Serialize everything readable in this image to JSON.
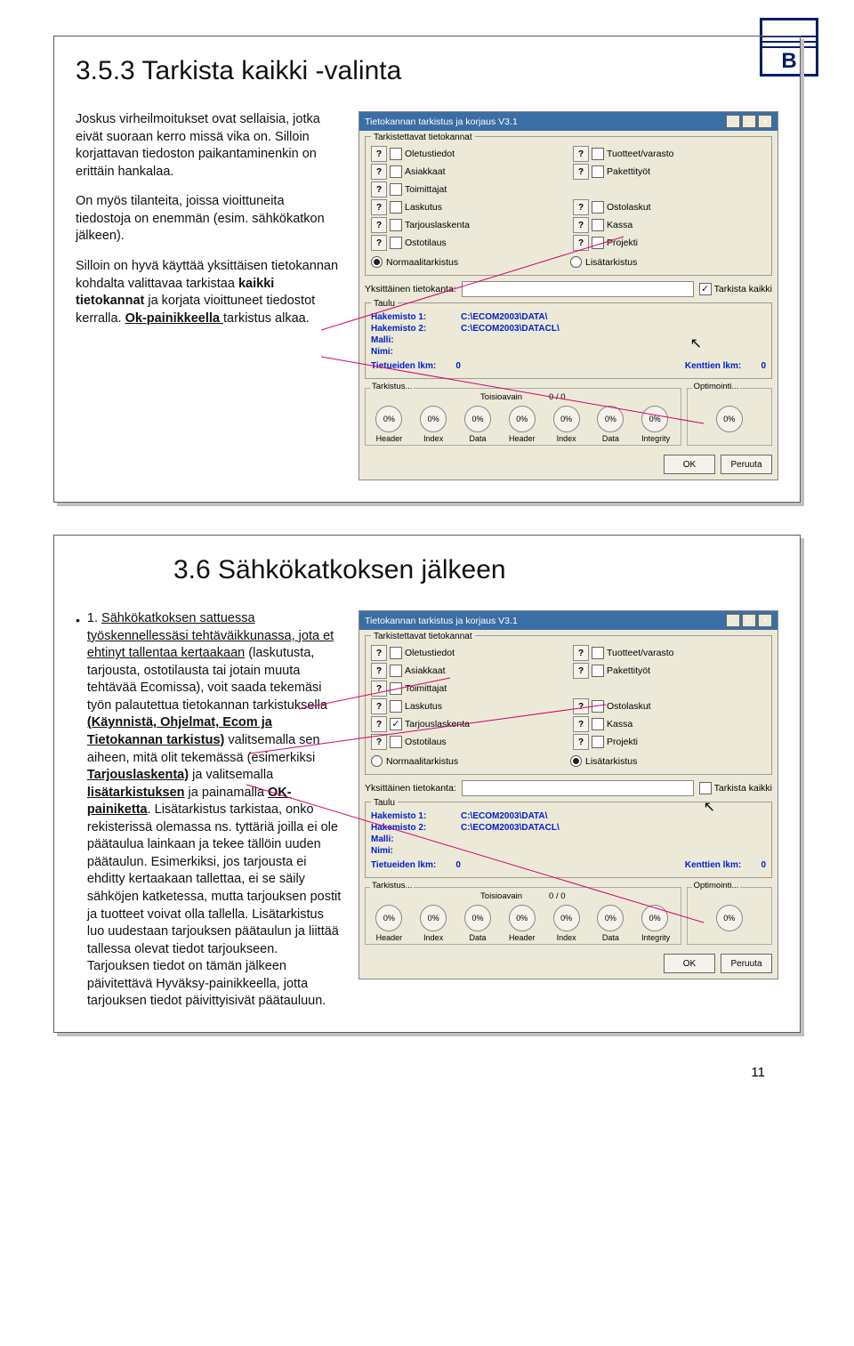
{
  "logo_letter": "B",
  "page_number": "11",
  "slide1": {
    "title": "3.5.3 Tarkista kaikki -valinta",
    "para1": "Joskus virheilmoitukset ovat sellaisia, jotka eivät suoraan kerro missä vika on. Silloin korjattavan tiedoston paikantaminenkin on erittäin hankalaa.",
    "para2": "On myös tilanteita, joissa vioittuneita tiedostoja on enemmän (esim. sähkökatkon jälkeen).",
    "para3a": "Silloin on hyvä käyttää yksittäisen tietokannan kohdalta valittavaa tarkistaa ",
    "para3b": "kaikki tietokannat",
    "para3c": " ja korjata vioittuneet tiedostot kerralla. ",
    "para3d": "Ok-painikkeella ",
    "para3e": "tarkistus alkaa."
  },
  "slide2": {
    "title": "3.6 Sähkökatkoksen jälkeen",
    "bullet_num": "1.",
    "t1": "Sähkökatkoksen sattuessa työskennellessäsi tehtäväikkunassa, jota et ehtinyt tallentaa kertaakaan",
    "t2": " (laskutusta, tarjousta, ostotilausta tai jotain muuta tehtävää Ecomissa), voit saada tekemäsi työn palautettua tietokannan tarkistuksella ",
    "t3": "(Käynnistä, Ohjelmat, Ecom ja Tietokannan tarkistus)",
    "t4": " valitsemalla sen aiheen, mitä olit tekemässä  (esimerkiksi ",
    "t5": "Tarjouslaskenta)",
    "t6": " ja valitsemalla ",
    "t7": "lisätarkistuksen",
    "t8": " ja painamalla ",
    "t9": "OK-painiketta",
    "t10": ". Lisätarkistus tarkistaa, onko rekisterissä olemassa ns. tyttäriä joilla ei ole päätaulua lainkaan ja tekee tällöin uuden päätaulun. Esimerkiksi, jos tarjousta ei ehditty kertaakaan tallettaa, ei se säily sähköjen katketessa, mutta tarjouksen postit ja tuotteet voivat olla tallella. Lisätarkistus luo uudestaan tarjouksen päätaulun ja liittää tallessa olevat tiedot tarjoukseen. Tarjouksen tiedot on tämän jälkeen päivitettävä Hyväksy-painikkeella, jotta tarjouksen tiedot päivittyisivät päätauluun."
  },
  "app1": {
    "title": "Tietokannan tarkistus ja korjaus V3.1",
    "group_dbs": "Tarkistettavat tietokannat",
    "dbs_left": [
      "Oletustiedot",
      "Asiakkaat",
      "Toimittajat",
      "Laskutus",
      "Tarjouslaskenta",
      "Ostotilaus"
    ],
    "dbs_right": [
      "Tuotteet/varasto",
      "Pakettityöt",
      "",
      "Ostolaskut",
      "Kassa",
      "Projekti"
    ],
    "mode_normal": "Normaalitarkistus",
    "mode_extra": "Lisätarkistus",
    "single_label": "Yksittäinen tietokanta:",
    "all_label": "Tarkista kaikki",
    "group_taulu": "Taulu",
    "hak1l": "Hakemisto 1:",
    "hak1v": "C:\\ECOM2003\\DATA\\",
    "hak2l": "Hakemisto 2:",
    "hak2v": "C:\\ECOM2003\\DATACL\\",
    "malli": "Malli:",
    "nimi": "Nimi:",
    "tiet_lkm": "Tietueiden lkm:",
    "kent_lkm": "Kenttien lkm:",
    "zero": "0",
    "tark_title": "Tarkistus...",
    "opt_title": "Optimointi...",
    "toisio": "Toisioavain",
    "toisio_count": "0   /   0",
    "pct": "0%",
    "caps": [
      "Header",
      "Index",
      "Data",
      "Header",
      "Index",
      "Data",
      "Integrity"
    ],
    "ok": "OK",
    "cancel": "Peruuta"
  }
}
